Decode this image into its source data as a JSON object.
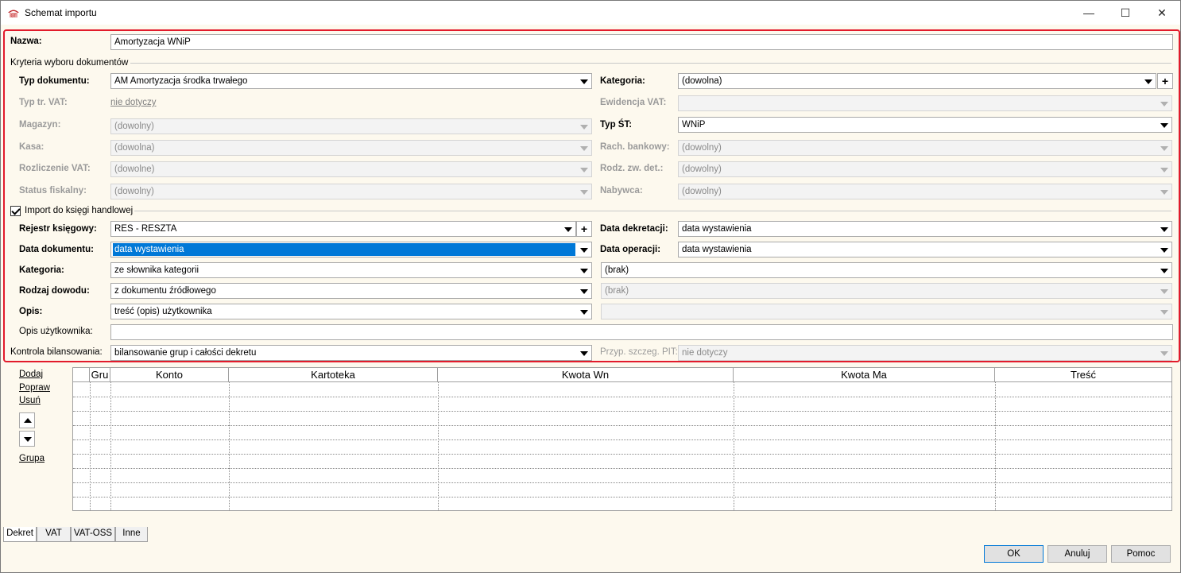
{
  "window": {
    "title": "Schemat importu",
    "min": "—",
    "max": "☐",
    "close": "✕"
  },
  "nazwa": {
    "label": "Nazwa:",
    "value": "Amortyzacja WNiP"
  },
  "kryteria": {
    "title": "Kryteria wyboru dokumentów",
    "typ_dokumentu": {
      "label": "Typ dokumentu:",
      "value": "AM Amortyzacja środka trwałego"
    },
    "kategoria": {
      "label": "Kategoria:",
      "value": "(dowolna)",
      "plus": "+"
    },
    "typ_tr_vat": {
      "label": "Typ tr. VAT:",
      "value": "nie dotyczy"
    },
    "ewidencja_vat": {
      "label": "Ewidencja VAT:",
      "value": ""
    },
    "magazyn": {
      "label": "Magazyn:",
      "value": "(dowolny)"
    },
    "typ_st": {
      "label": "Typ ŚT:",
      "value": "WNiP"
    },
    "kasa": {
      "label": "Kasa:",
      "value": "(dowolna)"
    },
    "rach_bankowy": {
      "label": "Rach. bankowy:",
      "value": "(dowolny)"
    },
    "rozliczenie_vat": {
      "label": "Rozliczenie VAT:",
      "value": "(dowolne)"
    },
    "rodz_zw_det": {
      "label": "Rodz. zw. det.:",
      "value": "(dowolny)"
    },
    "status_fiskalny": {
      "label": "Status fiskalny:",
      "value": "(dowolny)"
    },
    "nabywca": {
      "label": "Nabywca:",
      "value": "(dowolny)"
    }
  },
  "import": {
    "checkbox_label": "Import do księgi handlowej",
    "rejestr": {
      "label": "Rejestr księgowy:",
      "value": "RES - RESZTA",
      "plus": "+"
    },
    "data_dekretacji": {
      "label": "Data dekretacji:",
      "value": "data wystawienia"
    },
    "data_dokumentu": {
      "label": "Data dokumentu:",
      "value": "data wystawienia"
    },
    "data_operacji": {
      "label": "Data operacji:",
      "value": "data wystawienia"
    },
    "kategoria": {
      "label": "Kategoria:",
      "value": "ze słownika kategorii",
      "value2": "(brak)"
    },
    "rodzaj_dowodu": {
      "label": "Rodzaj dowodu:",
      "value": "z dokumentu źródłowego",
      "value2": "(brak)"
    },
    "opis": {
      "label": "Opis:",
      "value": "treść (opis) użytkownika",
      "value2": ""
    },
    "opis_uzytkownika": {
      "label": "Opis użytkownika:",
      "value": ""
    },
    "kontrola": {
      "label": "Kontrola bilansowania:",
      "value": "bilansowanie grup i całości dekretu"
    },
    "przyp_pit": {
      "label": "Przyp. szczeg. PIT:",
      "value": "nie dotyczy"
    }
  },
  "side": {
    "dodaj": "Dodaj",
    "popraw": "Popraw",
    "usun": "Usuń",
    "grupa": "Grupa"
  },
  "grid": {
    "columns": [
      "",
      "Gru",
      "Konto",
      "Kartoteka",
      "Kwota Wn",
      "Kwota Ma",
      "Treść"
    ]
  },
  "tabs": [
    "Dekret",
    "VAT",
    "VAT-OSS",
    "Inne"
  ],
  "buttons": {
    "ok": "OK",
    "anuluj": "Anuluj",
    "pomoc": "Pomoc"
  }
}
